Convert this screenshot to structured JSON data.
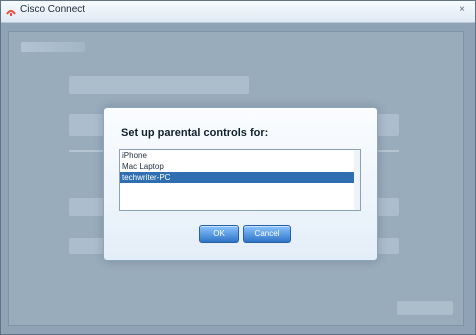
{
  "window": {
    "title": "Cisco Connect",
    "close_symbol": "×",
    "app_icon": "cisco-icon"
  },
  "modal": {
    "title": "Set up parental controls for:",
    "devices": [
      "iPhone",
      "Mac Laptop",
      "techwriter-PC"
    ],
    "selected_device": "techwriter-PC",
    "ok_label": "OK",
    "cancel_label": "Cancel"
  },
  "colors": {
    "accent": "#2f74c7",
    "selection": "#2f6fb1"
  }
}
